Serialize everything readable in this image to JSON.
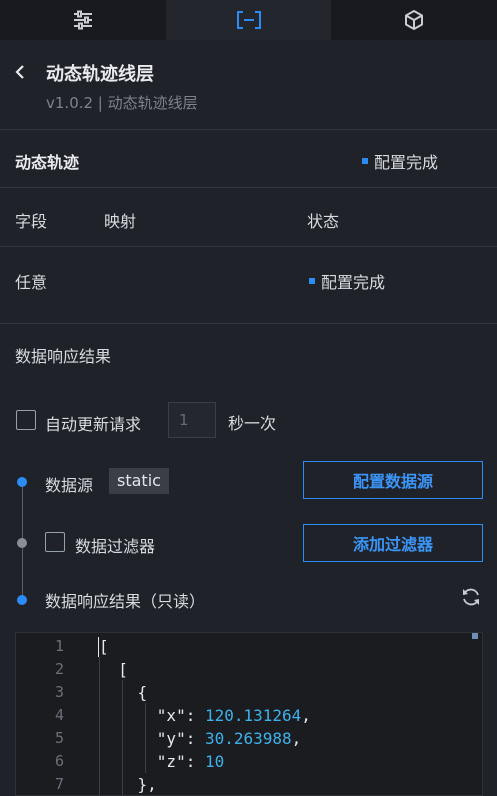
{
  "tabs": [
    {
      "icon": "sliders-icon"
    },
    {
      "icon": "bracket-select-icon",
      "active": true
    },
    {
      "icon": "cube-icon"
    }
  ],
  "header": {
    "title": "动态轨迹线层",
    "subtitle": "v1.0.2 | 动态轨迹线层"
  },
  "section": {
    "name": "动态轨迹",
    "status": "配置完成"
  },
  "table": {
    "col_field": "字段",
    "col_mapping": "映射",
    "col_status": "状态",
    "row_field": "任意",
    "row_status": "配置完成"
  },
  "response_title": "数据响应结果",
  "auto_update": {
    "label": "自动更新请求",
    "value": "1",
    "unit": "秒一次"
  },
  "datasource": {
    "label": "数据源",
    "tag": "static",
    "button": "配置数据源"
  },
  "filter": {
    "label": "数据过滤器",
    "button": "添加过滤器"
  },
  "result": {
    "label": "数据响应结果（只读）"
  },
  "code": {
    "line_numbers": [
      "1",
      "2",
      "3",
      "4",
      "5",
      "6",
      "7"
    ],
    "lines": [
      {
        "text": "["
      },
      {
        "text": "  ["
      },
      {
        "text": "    {"
      },
      {
        "key": "      \"x\": ",
        "val": "120.131264",
        "tail": ","
      },
      {
        "key": "      \"y\": ",
        "val": "30.263988",
        "tail": ","
      },
      {
        "key": "      \"z\": ",
        "val": "10",
        "tail": ""
      },
      {
        "text": "    },"
      }
    ]
  },
  "colors": {
    "accent": "#2b8cf6",
    "number": "#3fb1ea"
  }
}
